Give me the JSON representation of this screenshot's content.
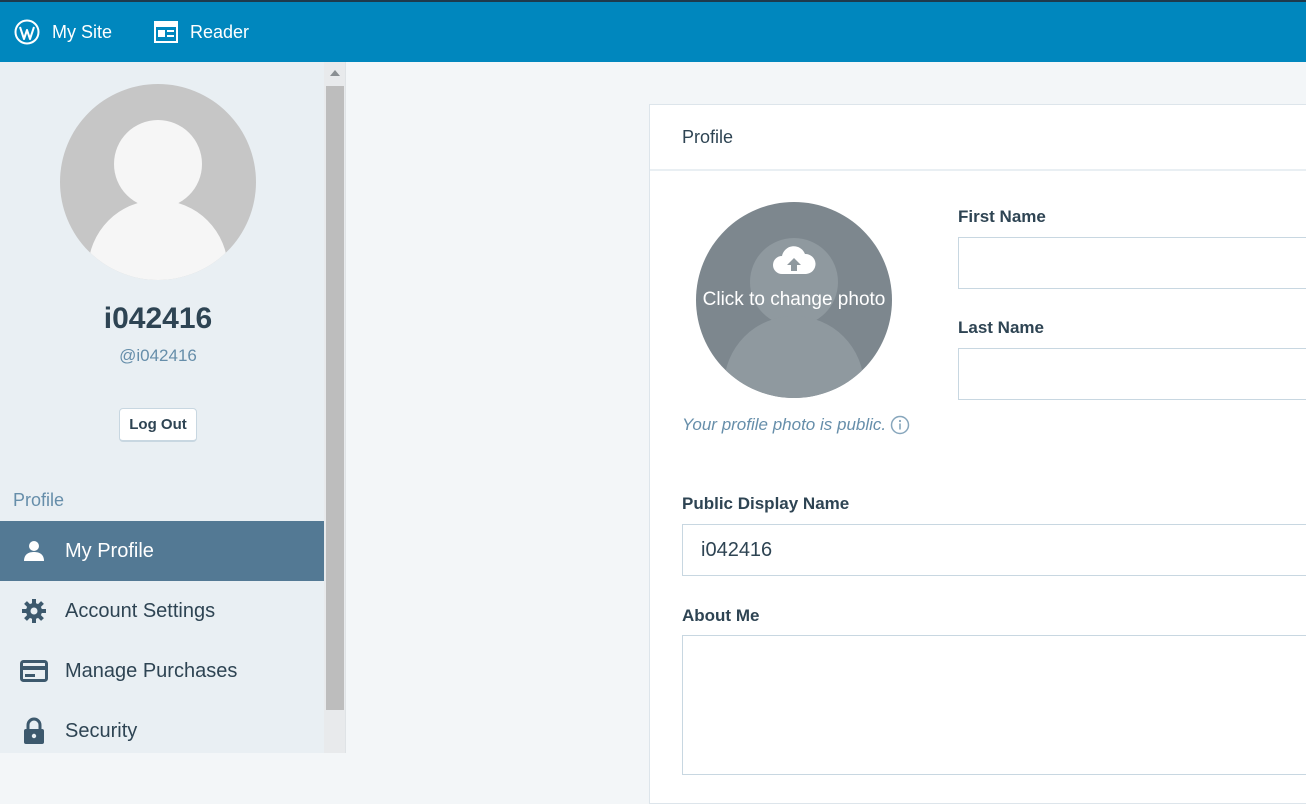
{
  "masterbar": {
    "my_site_label": "My Site",
    "reader_label": "Reader"
  },
  "sidebar": {
    "display_name": "i042416",
    "username": "@i042416",
    "logout_label": "Log Out",
    "section_heading": "Profile",
    "items": [
      {
        "label": "My Profile",
        "icon": "person-icon",
        "active": true
      },
      {
        "label": "Account Settings",
        "icon": "gear-icon",
        "active": false
      },
      {
        "label": "Manage Purchases",
        "icon": "credit-card-icon",
        "active": false
      },
      {
        "label": "Security",
        "icon": "lock-icon",
        "active": false
      }
    ]
  },
  "card": {
    "header_title": "Profile",
    "photo_picker_label": "Click to change photo",
    "photo_note": "Your profile photo is public.",
    "first_name_label": "First Name",
    "first_name_value": "",
    "last_name_label": "Last Name",
    "last_name_value": "",
    "display_name_label": "Public Display Name",
    "display_name_value": "i042416",
    "about_me_label": "About Me",
    "about_me_value": ""
  },
  "colors": {
    "masterbar": "#0087be",
    "sidebar_bg": "#e9eff3",
    "active_item_bg": "#537994",
    "page_bg": "#f3f6f8"
  }
}
